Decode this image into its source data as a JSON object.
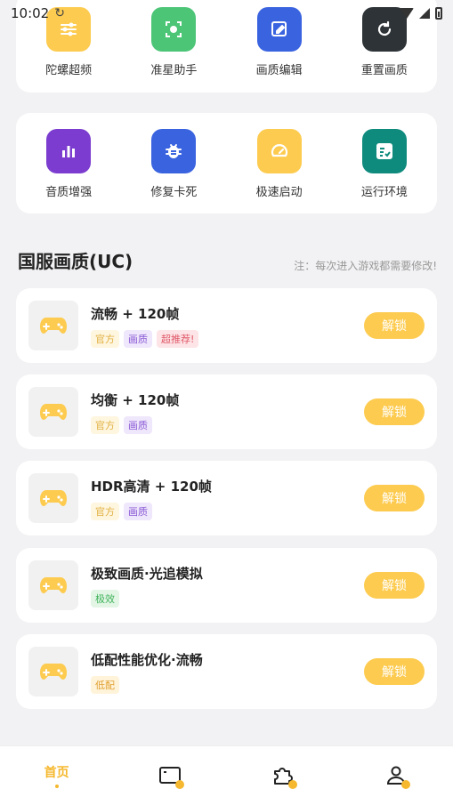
{
  "status": {
    "time": "10:02",
    "sync_glyph": "↻"
  },
  "grid_top": [
    {
      "label": "陀螺超频",
      "color": "#fdcb4f",
      "icon": "sliders-icon"
    },
    {
      "label": "准星助手",
      "color": "#4cc577",
      "icon": "crosshair-icon"
    },
    {
      "label": "画质编辑",
      "color": "#3a63e0",
      "icon": "edit-icon"
    },
    {
      "label": "重置画质",
      "color": "#2d3336",
      "icon": "refresh-icon"
    }
  ],
  "grid_bottom": [
    {
      "label": "音质增强",
      "color": "#7b3ccf",
      "icon": "bar-chart-icon"
    },
    {
      "label": "修复卡死",
      "color": "#3a63e0",
      "icon": "bug-icon"
    },
    {
      "label": "极速启动",
      "color": "#fdcb4f",
      "icon": "speedometer-icon"
    },
    {
      "label": "运行环境",
      "color": "#0f8b7d",
      "icon": "checklist-icon"
    }
  ],
  "section": {
    "title": "国服画质(UC)",
    "note": "注：每次进入游戏都需要修改!"
  },
  "unlock_label": "解锁",
  "items": [
    {
      "title": "流畅 + 120帧",
      "tags": [
        {
          "text": "官方",
          "kind": "official"
        },
        {
          "text": "画质",
          "kind": "quality"
        },
        {
          "text": "超推荐!",
          "kind": "recommend"
        }
      ]
    },
    {
      "title": "均衡 + 120帧",
      "tags": [
        {
          "text": "官方",
          "kind": "official"
        },
        {
          "text": "画质",
          "kind": "quality"
        }
      ]
    },
    {
      "title": "HDR高清 + 120帧",
      "tags": [
        {
          "text": "官方",
          "kind": "official"
        },
        {
          "text": "画质",
          "kind": "quality"
        }
      ]
    },
    {
      "title": "极致画质·光追模拟",
      "tags": [
        {
          "text": "极效",
          "kind": "effect"
        }
      ]
    },
    {
      "title": "低配性能优化·流畅",
      "tags": [
        {
          "text": "低配",
          "kind": "low"
        }
      ]
    }
  ],
  "nav": {
    "home_label": "首页"
  },
  "colors": {
    "accent": "#fdcb4f",
    "nav_active": "#f5b82e"
  }
}
